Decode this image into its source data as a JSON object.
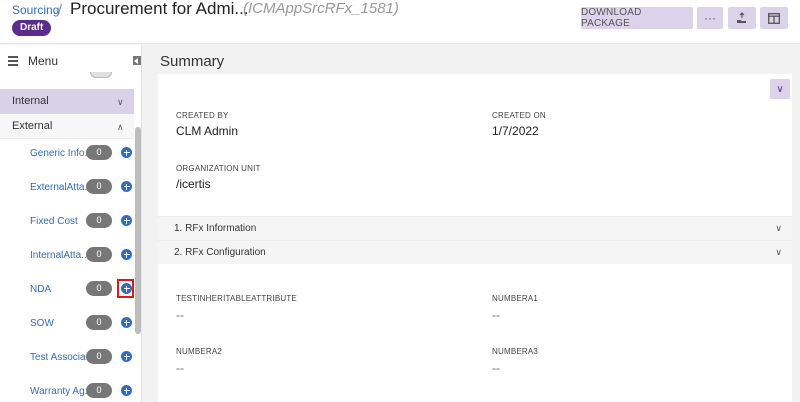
{
  "header": {
    "breadcrumb": "Sourcing",
    "separator": "/",
    "title": "Procurement for Admi...",
    "code": "(ICMAppSrcRFx_1581)",
    "status": "Draft",
    "download_label": "DOWNLOAD PACKAGE",
    "more_label": "···",
    "colors": {
      "accent": "#5b2c8e",
      "button_bg": "#dcd3eb",
      "link": "#2f6cc4"
    }
  },
  "sidebar": {
    "menu_label": "Menu",
    "sections": [
      {
        "label": "Internal",
        "expanded": false
      },
      {
        "label": "External",
        "expanded": true
      }
    ],
    "items": [
      {
        "label": "Generic Info...",
        "count": "0"
      },
      {
        "label": "ExternalAtta...",
        "count": "0"
      },
      {
        "label": "Fixed Cost",
        "count": "0"
      },
      {
        "label": "InternalAtta...",
        "count": "0"
      },
      {
        "label": "NDA",
        "count": "0"
      },
      {
        "label": "SOW",
        "count": "0"
      },
      {
        "label": "Test Associa...",
        "count": "0"
      },
      {
        "label": "Warranty Ag...",
        "count": "0"
      }
    ]
  },
  "main": {
    "title": "Summary",
    "fields": {
      "created_by": {
        "label": "CREATED BY",
        "value": "CLM Admin"
      },
      "created_on": {
        "label": "CREATED ON",
        "value": "1/7/2022"
      },
      "org_unit": {
        "label": "ORGANIZATION UNIT",
        "value": "/icertis"
      }
    },
    "accordions": [
      {
        "label": "1. RFx Information"
      },
      {
        "label": "2. RFx Configuration"
      }
    ],
    "config_fields": {
      "test_inheritable": {
        "label": "TESTINHERITABLEATTRIBUTE",
        "value": "--"
      },
      "numbera1": {
        "label": "NUMBERA1",
        "value": "--"
      },
      "numbera2": {
        "label": "NUMBERA2",
        "value": "--"
      },
      "numbera3": {
        "label": "NUMBERA3",
        "value": "--"
      }
    }
  }
}
